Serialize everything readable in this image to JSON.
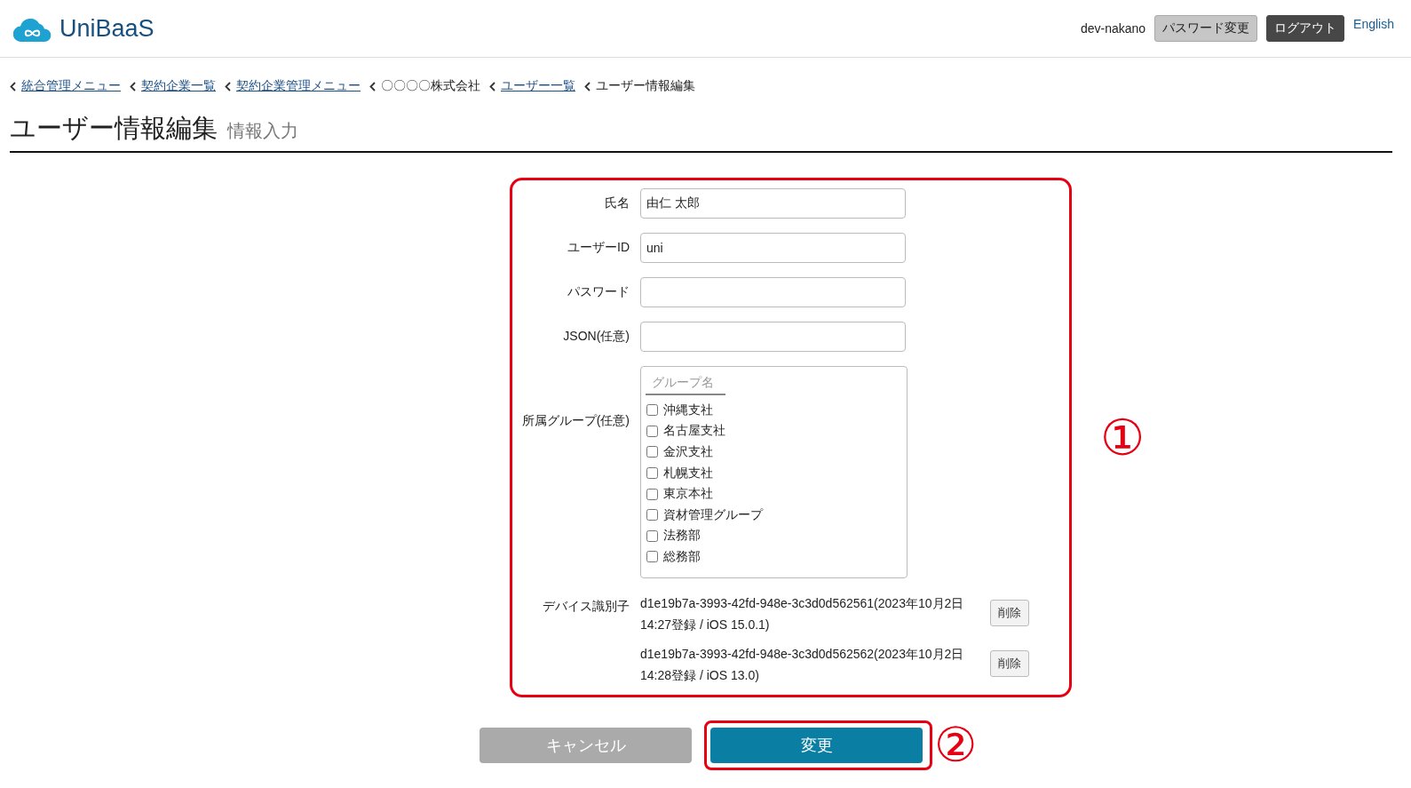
{
  "header": {
    "logo": "UniBaaS",
    "user": "dev-nakano",
    "buttons": [
      {
        "label": "パスワード変更",
        "kind": "light"
      },
      {
        "label": "ログアウト",
        "kind": "dark"
      }
    ],
    "language_link": "English"
  },
  "breadcrumb": [
    {
      "label": "統合管理メニュー",
      "kind": "link"
    },
    {
      "label": "契約企業一覧",
      "kind": "link"
    },
    {
      "label": "契約企業管理メニュー",
      "kind": "link"
    },
    {
      "label": "〇〇〇〇株式会社",
      "kind": "text"
    },
    {
      "label": "ユーザー一覧",
      "kind": "link"
    },
    {
      "label": "ユーザー情報編集",
      "kind": "text"
    }
  ],
  "page_title": {
    "title": "ユーザー情報編集",
    "subtitle": "情報入力"
  },
  "form": {
    "annotation": "①",
    "fields": [
      {
        "label": "氏名",
        "value": "由仁 太郎"
      },
      {
        "label": "ユーザーID",
        "value": "uni"
      },
      {
        "label": "パスワード"
      },
      {
        "label": "JSON(任意)"
      }
    ],
    "groups": {
      "label": "所属グループ(任意)",
      "placeholder": "グループ名",
      "items": [
        {
          "label": "沖縄支社",
          "checked": false
        },
        {
          "label": "名古屋支社",
          "checked": false
        },
        {
          "label": "金沢支社",
          "checked": false
        },
        {
          "label": "札幌支社",
          "checked": false
        },
        {
          "label": "東京本社",
          "checked": false
        },
        {
          "label": "資材管理グループ",
          "checked": false
        },
        {
          "label": "法務部",
          "checked": false
        },
        {
          "label": "総務部",
          "checked": false
        }
      ]
    },
    "devices": {
      "label": "デバイス識別子",
      "items": [
        {
          "text": "d1e19b7a-3993-42fd-948e-3c3d0d562561(2023年10月2日14:27登録 / iOS 15.0.1)",
          "button": "削除"
        },
        {
          "text": "d1e19b7a-3993-42fd-948e-3c3d0d562562(2023年10月2日14:28登録 / iOS 13.0)",
          "button": "削除"
        }
      ]
    }
  },
  "actions": [
    {
      "label": "キャンセル",
      "kind": "cancel"
    },
    {
      "label": "変更",
      "kind": "primary",
      "annotation": "②"
    }
  ]
}
